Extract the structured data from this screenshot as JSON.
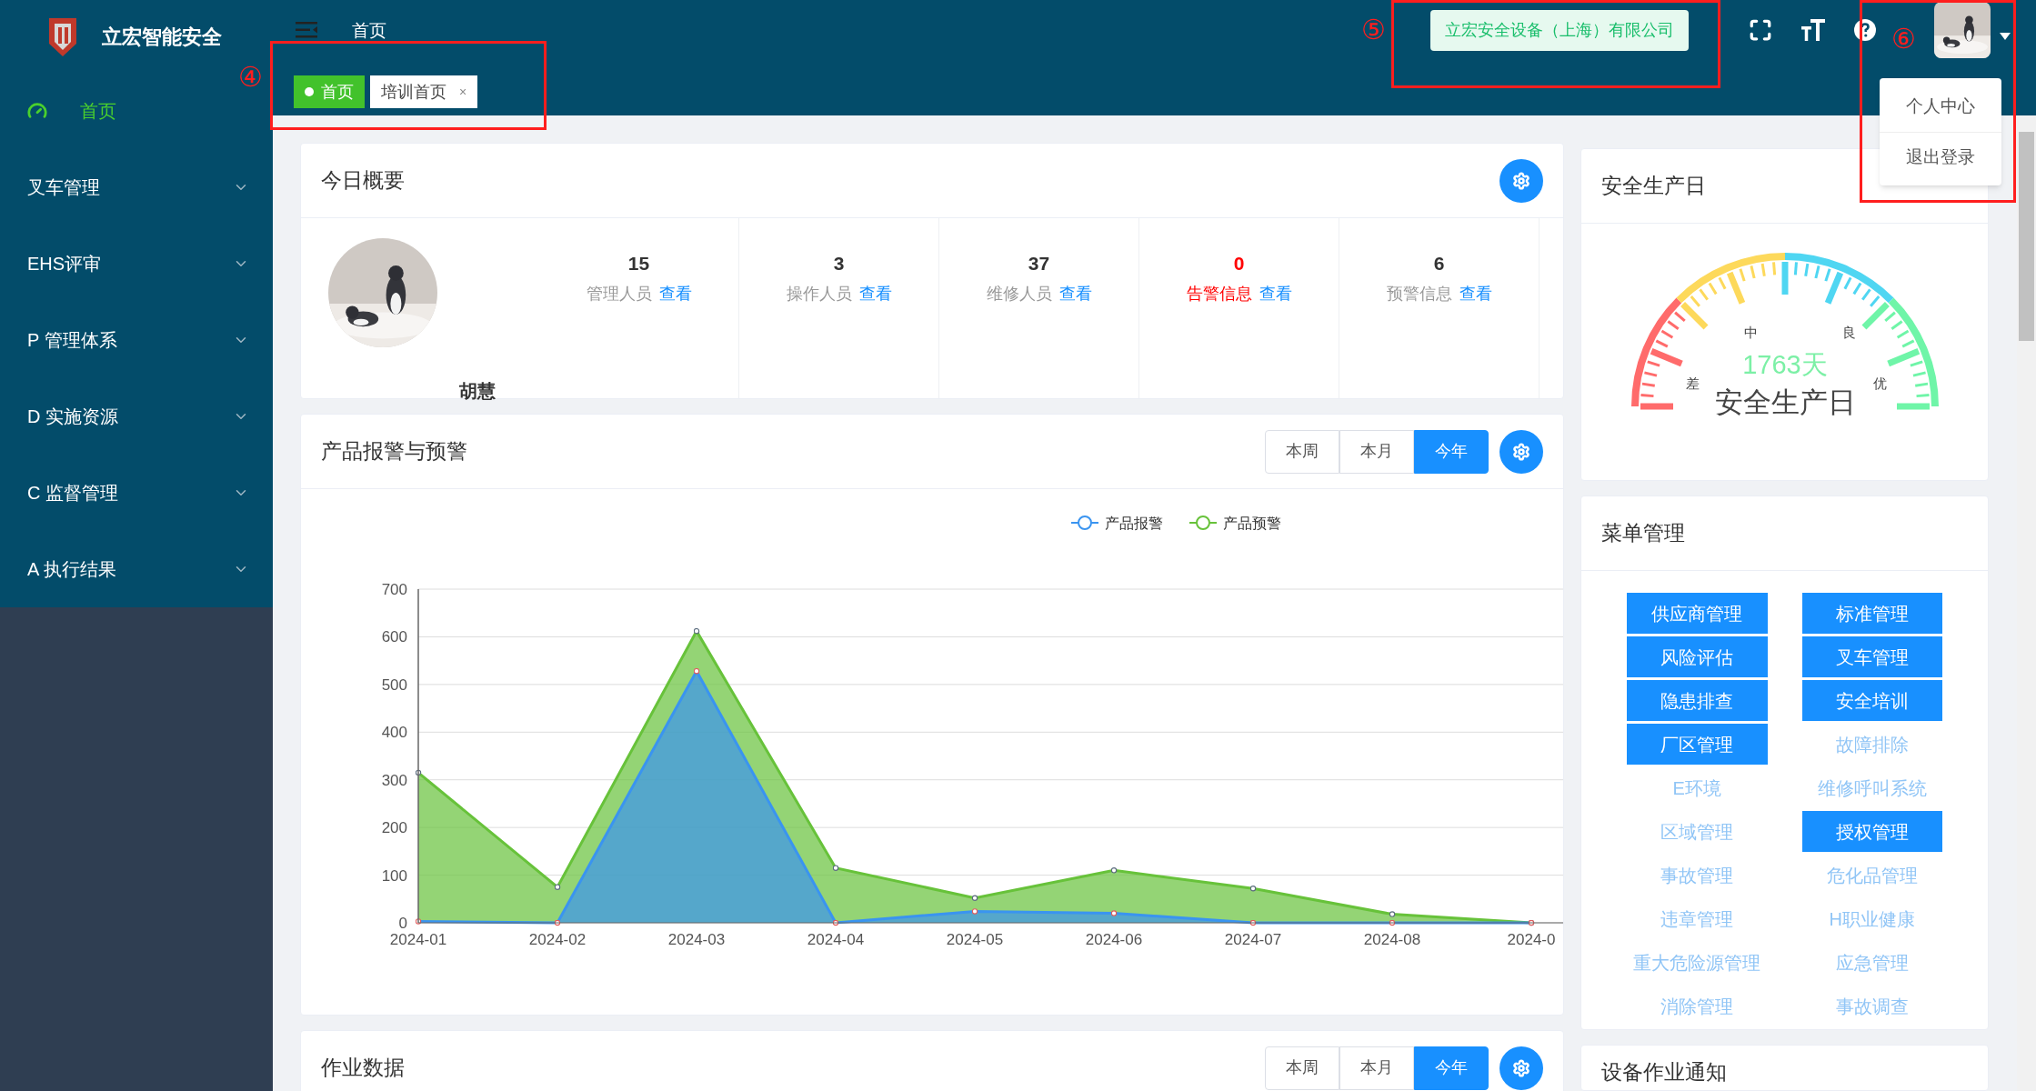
{
  "sidebar": {
    "brand": "立宏智能安全",
    "items": [
      {
        "label": "首页",
        "selected": true,
        "kind": "link"
      },
      {
        "label": "叉车管理",
        "selected": false,
        "kind": "group"
      },
      {
        "label": "EHS评审",
        "selected": false,
        "kind": "group"
      },
      {
        "label": "P 管理体系",
        "selected": false,
        "kind": "group"
      },
      {
        "label": "D 实施资源",
        "selected": false,
        "kind": "group"
      },
      {
        "label": "C 监督管理",
        "selected": false,
        "kind": "group"
      },
      {
        "label": "A 执行结果",
        "selected": false,
        "kind": "group"
      }
    ]
  },
  "header": {
    "breadcrumb": "首页",
    "company": "立宏安全设备（上海）有限公司",
    "user_menu": {
      "expanded": true,
      "items": [
        "个人中心",
        "退出登录"
      ]
    }
  },
  "tabs": [
    {
      "label": "首页",
      "selected": true,
      "closable": false
    },
    {
      "label": "培训首页",
      "selected": false,
      "closable": true,
      "close": "×"
    }
  ],
  "annotations": [
    {
      "label": "④"
    },
    {
      "label": "⑤"
    },
    {
      "label": "⑥"
    }
  ],
  "overview": {
    "title": "今日概要",
    "user": "胡慧",
    "stats": [
      {
        "value": "15",
        "label": "管理人员",
        "link": "查看",
        "alert": false
      },
      {
        "value": "3",
        "label": "操作人员",
        "link": "查看",
        "alert": false
      },
      {
        "value": "37",
        "label": "维修人员",
        "link": "查看",
        "alert": false
      },
      {
        "value": "0",
        "label": "告警信息",
        "link": "查看",
        "alert": true
      },
      {
        "value": "6",
        "label": "预警信息",
        "link": "查看",
        "alert": false
      }
    ]
  },
  "alarm_card": {
    "title": "产品报警与预警",
    "periods": [
      {
        "label": "本周",
        "selected": false
      },
      {
        "label": "本月",
        "selected": false
      },
      {
        "label": "今年",
        "selected": true
      }
    ],
    "chart_data": {
      "type": "area",
      "grid": true,
      "legend": true,
      "categories": [
        "2024-01",
        "2024-02",
        "2024-03",
        "2024-04",
        "2024-05",
        "2024-06",
        "2024-07",
        "2024-08",
        "2024-0"
      ],
      "ylim": [
        0,
        700
      ],
      "yticks": [
        0,
        100,
        200,
        300,
        400,
        500,
        600,
        700
      ],
      "series": [
        {
          "name": "产品报警",
          "color": "#3a94f0",
          "values": [
            3,
            0,
            528,
            0,
            24,
            20,
            0,
            0,
            0
          ]
        },
        {
          "name": "产品预警",
          "color": "#67c23a",
          "values": [
            315,
            75,
            612,
            115,
            52,
            110,
            72,
            18,
            0
          ]
        }
      ]
    }
  },
  "work_card": {
    "title": "作业数据",
    "periods": [
      {
        "label": "本周",
        "selected": false
      },
      {
        "label": "本月",
        "selected": false
      },
      {
        "label": "今年",
        "selected": true
      }
    ]
  },
  "safety_card": {
    "title": "安全生产日",
    "days": "1763天",
    "caption": "安全生产日",
    "grades": [
      "差",
      "中",
      "良",
      "优"
    ]
  },
  "menu_card": {
    "title": "菜单管理",
    "items": [
      {
        "label": "供应商管理",
        "enabled": true
      },
      {
        "label": "标准管理",
        "enabled": true
      },
      {
        "label": "风险评估",
        "enabled": true
      },
      {
        "label": "叉车管理",
        "enabled": true
      },
      {
        "label": "隐患排查",
        "enabled": true
      },
      {
        "label": "安全培训",
        "enabled": true
      },
      {
        "label": "厂区管理",
        "enabled": true
      },
      {
        "label": "故障排除",
        "enabled": false
      },
      {
        "label": "E环境",
        "enabled": false
      },
      {
        "label": "维修呼叫系统",
        "enabled": false
      },
      {
        "label": "区域管理",
        "enabled": false
      },
      {
        "label": "授权管理",
        "enabled": true
      },
      {
        "label": "事故管理",
        "enabled": false
      },
      {
        "label": "危化品管理",
        "enabled": false
      },
      {
        "label": "违章管理",
        "enabled": false
      },
      {
        "label": "H职业健康",
        "enabled": false
      },
      {
        "label": "重大危险源管理",
        "enabled": false
      },
      {
        "label": "应急管理",
        "enabled": false
      },
      {
        "label": "消除管理",
        "enabled": false
      },
      {
        "label": "事故调查",
        "enabled": false
      }
    ]
  },
  "notice_card": {
    "title": "设备作业通知"
  }
}
